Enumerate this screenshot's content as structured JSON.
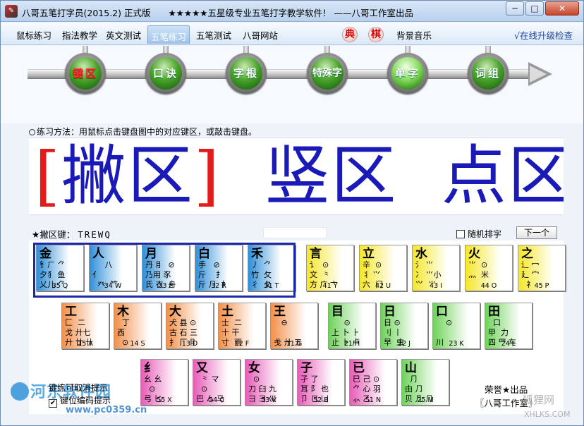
{
  "window": {
    "title": "八哥五笔打字员(2015.2) 正式版　　★★★★★五星级专业五笔打字教学软件！ ——八哥工作室出品",
    "min_label": "─",
    "max_label": "□",
    "close_label": "✕"
  },
  "menu": {
    "tabs": [
      "鼠标练习",
      "指法教学",
      "英文测试",
      "五笔练习",
      "五笔测试",
      "八哥网站"
    ],
    "active_tab": "五笔练习",
    "dian": "典",
    "qi": "棋",
    "bg_music": "背景音乐",
    "upgrade": "√在线升级检查"
  },
  "steps": [
    {
      "label": "键区",
      "state": "red"
    },
    {
      "label": "口诀",
      "state": "normal"
    },
    {
      "label": "字根",
      "state": "normal"
    },
    {
      "label": "特殊字",
      "state": "normal"
    },
    {
      "label": "单字",
      "state": "lit"
    },
    {
      "label": "词组",
      "state": "normal"
    }
  ],
  "hint": "练习方法：用鼠标点击键盘图中的对应键区，或敲击键盘。",
  "big_display": {
    "bracket_left": "[",
    "current": "撇区",
    "bracket_right": "]",
    "next1": "竖区",
    "next2": "点区"
  },
  "zone_row": {
    "label": "★撇区键：",
    "keys": "TREWQ",
    "random_label": "随机排字",
    "next_button": "下一个"
  },
  "keys": [
    {
      "main": "金",
      "comp": "钅ㄏ ⺈\n夕犭 鱼\n乂儿 ⺈",
      "code": "35 Q",
      "color": "blue"
    },
    {
      "main": "人",
      "comp": "     八\n亻\n  癶  ⺮",
      "code": "34 W",
      "color": "blue"
    },
    {
      "main": "月",
      "comp": "丹 ⺝  ⊘\n乃用 豕\n氏 衣  舟",
      "code": "33 E",
      "color": "blue"
    },
    {
      "main": "白",
      "comp": "手   ⊘\n斤    ⺘\n斤 ⺆  ⺘",
      "code": "32 R",
      "color": "blue"
    },
    {
      "main": "禾",
      "comp": "丿  ⺈\n竹  攵\n彳  夂",
      "code": "31 T",
      "color": "blue"
    },
    {
      "main": "言",
      "comp": "讠  ⊙\n文  ⺀\n方 广 ⼇",
      "code": "41 Y",
      "color": "yellow"
    },
    {
      "main": "立",
      "comp": "辛  ⊙\n丬 ⺍\n六  门",
      "code": "42 U",
      "color": "yellow"
    },
    {
      "main": "水",
      "comp": "氵 ⺌\n冫 ⺌小\n⺍  ⺌",
      "code": "43 I",
      "color": "yellow"
    },
    {
      "main": "火",
      "comp": "⺌  ⊙\n灬  米",
      "code": "44 O",
      "color": "yellow"
    },
    {
      "main": "之",
      "comp": "辶 冖\n⼵ 宀\n  礻",
      "code": "45 P",
      "color": "yellow"
    },
    {
      "main": "工",
      "comp": "匚  二\n戈 ⼶七\n廾 廿 卄",
      "code": "15 A",
      "color": "orange"
    },
    {
      "main": "木",
      "comp": "  丁\n西\n  ⊙",
      "code": "14 S",
      "color": "orange"
    },
    {
      "main": "大",
      "comp": "犬 县 ⊙\n古 石 三\n⺘ 厂 ⺝",
      "code": "13 D",
      "color": "orange"
    },
    {
      "main": "土",
      "comp": "士  二\n十 ⼲\n寸  雨",
      "code": "12 F",
      "color": "orange"
    },
    {
      "main": "王",
      "comp": "   ⊖\n\n戋 ⼶ 五",
      "code": "11 G",
      "color": "orange"
    },
    {
      "main": "目",
      "comp": "     ⊙\n上 卜 ⺊\n止 ⺊ 卢",
      "code": "21 H",
      "color": "green"
    },
    {
      "main": "日",
      "comp": "日 ⊙\n刂 ⼁\n早  虫",
      "code": "22 J",
      "color": "green"
    },
    {
      "main": "口",
      "comp": "    ⊙\n\n川",
      "code": "23 K",
      "color": "green"
    },
    {
      "main": "田",
      "comp": "  口\n甲  力\n四 ⺲ 车",
      "code": "24 L",
      "color": "green"
    },
    {
      "main": "纟",
      "comp": "幺 ⺓\n  ⊙\n弓 匕",
      "code": "55 X",
      "color": "pink"
    },
    {
      "main": "又",
      "comp": "  ⺀ マ\n  ⊙\n巴 ⼛ 马",
      "code": "54 C",
      "color": "pink"
    },
    {
      "main": "女",
      "comp": "  ⊙\n刀 臼 九\n⺕ ⺕ 巛",
      "code": "53 V",
      "color": "pink"
    },
    {
      "main": "子",
      "comp": "孑 了\n耳 阝 也\n卩 ⺋ 凵",
      "code": "52 B",
      "color": "pink"
    },
    {
      "main": "已",
      "comp": "巳 己 ⊙\n⺈ 心 羽\n⺗ 乙",
      "code": "51 N",
      "color": "pink"
    },
    {
      "main": "山",
      "comp": "  ⺆\n由 ⺆\n贝 几 ⺆",
      "code": "25 M",
      "color": "green"
    }
  ],
  "bottom": {
    "opt1": "键练可取消提示",
    "opt2": "键位编码提示",
    "credit": "荣誉★出品",
    "studio": "〖八哥工作室〗"
  },
  "watermarks": {
    "site1": "河东软件园",
    "site1_url": "www.pc0359.cn",
    "site2": "狐狸网",
    "site2_url": "XHLKS.COM"
  },
  "colors": {
    "zone_selection_border": "#1b2aa8",
    "bracket": "#e31b1b",
    "big_text": "#1a1ab8"
  }
}
